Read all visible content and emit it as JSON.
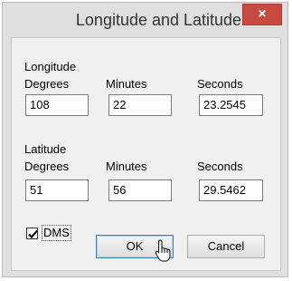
{
  "dialog": {
    "title": "Longitude and Latitude",
    "close_glyph": "×",
    "close_color": "#c74b40"
  },
  "longitude": {
    "section_label": "Longitude",
    "degrees_label": "Degrees",
    "minutes_label": "Minutes",
    "seconds_label": "Seconds",
    "degrees": "108",
    "minutes": "22",
    "seconds": "23.2545"
  },
  "latitude": {
    "section_label": "Latitude",
    "degrees_label": "Degrees",
    "minutes_label": "Minutes",
    "seconds_label": "Seconds",
    "degrees": "51",
    "minutes": "56",
    "seconds": "29.5462"
  },
  "dms": {
    "label": "DMS",
    "checked": true
  },
  "buttons": {
    "ok": "OK",
    "cancel": "Cancel"
  },
  "icons": {
    "close": "close-icon",
    "check": "checkmark-icon",
    "cursor": "mouse-pointer-icon"
  }
}
